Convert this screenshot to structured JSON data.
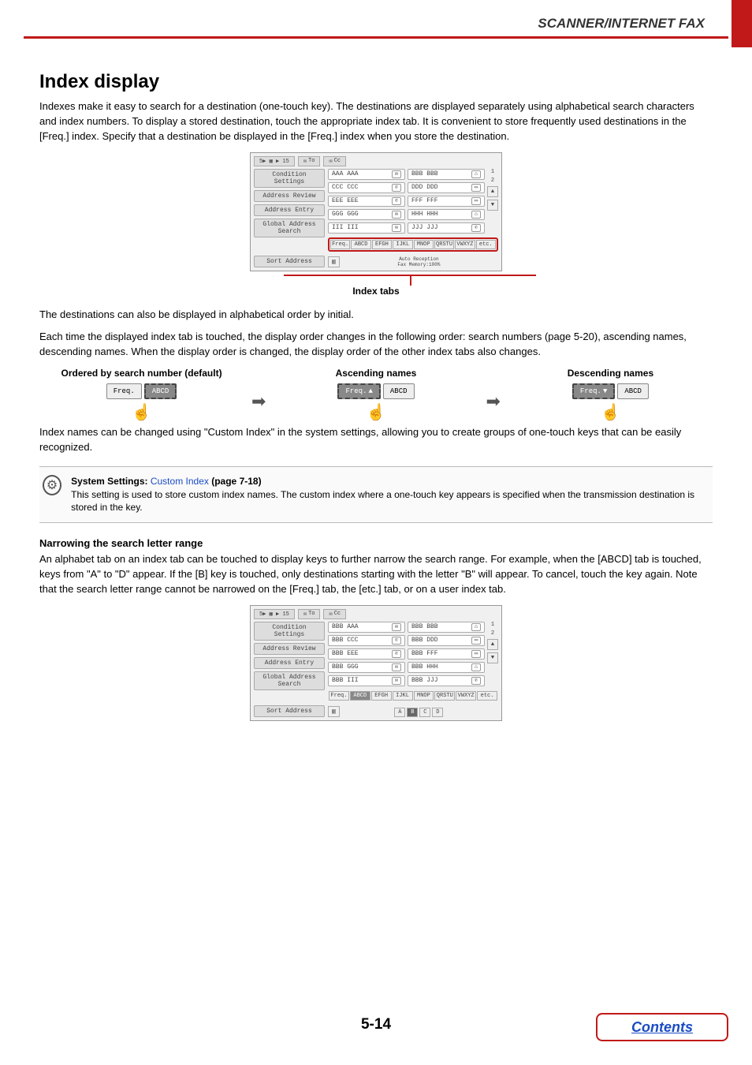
{
  "header": {
    "section": "SCANNER/INTERNET FAX"
  },
  "title": "Index display",
  "intro": "Indexes make it easy to search for a destination (one-touch key). The destinations are displayed separately using alphabetical search characters and index numbers. To display a stored destination, touch the appropriate index tab. It is convenient to store frequently used destinations in the [Freq.] index. Specify that a destination be displayed in the [Freq.] index when you store the destination.",
  "panel1": {
    "pages": "5▶ ▦ ▶ 15",
    "to": "To",
    "cc": "Cc",
    "left_buttons": [
      "Condition Settings",
      "Address Review",
      "Address Entry",
      "Global Address Search"
    ],
    "sort_button": "Sort Address",
    "keys_col1": [
      "AAA AAA",
      "CCC CCC",
      "EEE EEE",
      "GGG GGG",
      "III III"
    ],
    "keys_col2": [
      "BBB BBB",
      "DDD DDD",
      "FFF FFF",
      "HHH HHH",
      "JJJ JJJ"
    ],
    "strip": [
      "Freq.",
      "ABCD",
      "EFGH",
      "IJKL",
      "MNOP",
      "QRSTU",
      "VWXYZ",
      "etc."
    ],
    "side_nums": [
      "1",
      "2"
    ],
    "status1": "Auto Reception",
    "status2": "Fax Memory:100%",
    "caption": "Index tabs"
  },
  "para2": "The destinations can also be displayed in alphabetical order by initial.",
  "para3": "Each time the displayed index tab is touched, the display order changes in the following order: search numbers (page 5-20), ascending names, descending names. When the display order is changed, the display order of the other index tabs also changes.",
  "order": {
    "labels": [
      "Ordered by search number (default)",
      "Ascending names",
      "Descending names"
    ],
    "freq": "Freq.",
    "abcd": "ABCD",
    "asc": "▲",
    "desc": "▼"
  },
  "para4": "Index names can be changed using \"Custom Index\" in the system settings, allowing you to create groups of one-touch keys that can be easily recognized.",
  "note": {
    "line1a": "System Settings: ",
    "link": "Custom Index",
    "line1b": " (page 7-18)",
    "body": "This setting is used to store custom index names. The custom index where a one-touch key appears is specified when the transmission destination is stored in the key."
  },
  "narrow": {
    "heading": "Narrowing the search letter range",
    "body": "An alphabet tab on an index tab can be touched to display keys to further narrow the search range. For example, when the [ABCD] tab is touched, keys from \"A\" to \"D\" appear. If the [B] key is touched, only destinations starting with the letter \"B\" will appear. To cancel, touch the key again. Note that the search letter range cannot be narrowed on the [Freq.] tab, the [etc.] tab, or on a user index tab."
  },
  "panel2": {
    "keys_col1": [
      "BBB AAA",
      "BBB CCC",
      "BBB EEE",
      "BBB GGG",
      "BBB III"
    ],
    "keys_col2": [
      "BBB BBB",
      "BBB DDD",
      "BBB FFF",
      "BBB HHH",
      "BBB JJJ"
    ],
    "strip": [
      "Freq.",
      "ABCD",
      "EFGH",
      "IJKL",
      "MNOP",
      "QRSTU",
      "VWXYZ",
      "etc."
    ],
    "letters": [
      "A",
      "B",
      "C",
      "D"
    ]
  },
  "footer": {
    "page": "5-14",
    "contents": "Contents"
  }
}
